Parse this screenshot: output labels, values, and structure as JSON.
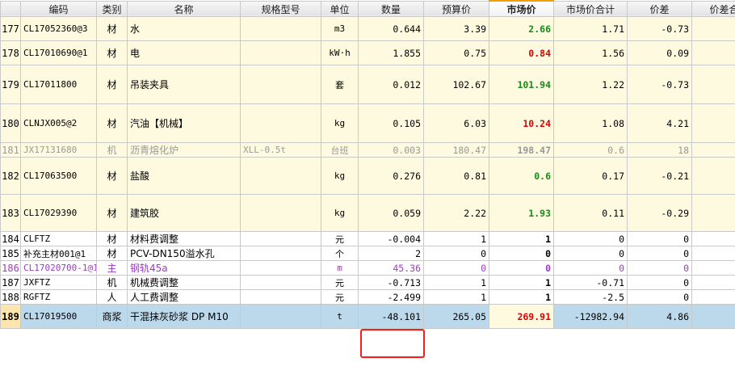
{
  "columns": {
    "index": "",
    "code": "编码",
    "category": "类别",
    "name": "名称",
    "spec": "规格型号",
    "unit": "单位",
    "quantity": "数量",
    "budget_price": "预算价",
    "market_price": "市场价",
    "market_total": "市场价合计",
    "price_diff": "价差",
    "diff_total": "价差合"
  },
  "rows": [
    {
      "idx": "177",
      "code": "CL17052360@3",
      "cat": "材",
      "name": "水",
      "spec": "",
      "unit": "m3",
      "qty": "0.644",
      "budget": "3.39",
      "market": "2.66",
      "market_color": "green",
      "total": "1.71",
      "diff": "-0.73",
      "style": "yellow"
    },
    {
      "idx": "178",
      "code": "CL17010690@1",
      "cat": "材",
      "name": "电",
      "spec": "",
      "unit": "kW·h",
      "qty": "1.855",
      "budget": "0.75",
      "market": "0.84",
      "market_color": "red",
      "total": "1.56",
      "diff": "0.09",
      "style": "yellow"
    },
    {
      "idx": "179",
      "code": "CL17011800",
      "cat": "材",
      "name": "吊装夹具",
      "spec": "",
      "unit": "套",
      "qty": "0.012",
      "budget": "102.67",
      "market": "101.94",
      "market_color": "green",
      "total": "1.22",
      "diff": "-0.73",
      "style": "yellow"
    },
    {
      "idx": "180",
      "code": "CLNJX005@2",
      "cat": "材",
      "name": "汽油【机械】",
      "spec": "",
      "unit": "kg",
      "qty": "0.105",
      "budget": "6.03",
      "market": "10.24",
      "market_color": "red",
      "total": "1.08",
      "diff": "4.21",
      "style": "yellow"
    },
    {
      "idx": "181",
      "code": "JX17131680",
      "cat": "机",
      "name": "沥青熔化炉",
      "spec": "XLL-0.5t",
      "unit": "台班",
      "qty": "0.003",
      "budget": "180.47",
      "market": "198.47",
      "market_color": "red",
      "total": "0.6",
      "diff": "18",
      "style": "gray"
    },
    {
      "idx": "182",
      "code": "CL17063500",
      "cat": "材",
      "name": "盐酸",
      "spec": "",
      "unit": "kg",
      "qty": "0.276",
      "budget": "0.81",
      "market": "0.6",
      "market_color": "green",
      "total": "0.17",
      "diff": "-0.21",
      "style": "yellow"
    },
    {
      "idx": "183",
      "code": "CL17029390",
      "cat": "材",
      "name": "建筑胶",
      "spec": "",
      "unit": "kg",
      "qty": "0.059",
      "budget": "2.22",
      "market": "1.93",
      "market_color": "green",
      "total": "0.11",
      "diff": "-0.29",
      "style": "yellow"
    },
    {
      "idx": "184",
      "code": "CLFTZ",
      "cat": "材",
      "name": "材料费调整",
      "spec": "",
      "unit": "元",
      "qty": "-0.004",
      "budget": "1",
      "market": "1",
      "market_color": "black",
      "total": "0",
      "diff": "0",
      "style": "white"
    },
    {
      "idx": "185",
      "code": "补充主材001@1",
      "cat": "材",
      "name": "PCV-DN150溢水孔",
      "spec": "",
      "unit": "个",
      "qty": "2",
      "budget": "0",
      "market": "0",
      "market_color": "black",
      "total": "0",
      "diff": "0",
      "style": "white"
    },
    {
      "idx": "186",
      "code": "CL17020700-1@1",
      "cat": "主",
      "name": "钢轨45a",
      "spec": "",
      "unit": "m",
      "qty": "45.36",
      "budget": "0",
      "market": "0",
      "market_color": "black",
      "total": "0",
      "diff": "0",
      "style": "purple"
    },
    {
      "idx": "187",
      "code": "JXFTZ",
      "cat": "机",
      "name": "机械费调整",
      "spec": "",
      "unit": "元",
      "qty": "-0.713",
      "budget": "1",
      "market": "1",
      "market_color": "black",
      "total": "-0.71",
      "diff": "0",
      "style": "white"
    },
    {
      "idx": "188",
      "code": "RGFTZ",
      "cat": "人",
      "name": "人工费调整",
      "spec": "",
      "unit": "元",
      "qty": "-2.499",
      "budget": "1",
      "market": "1",
      "market_color": "black",
      "total": "-2.5",
      "diff": "0",
      "style": "white"
    },
    {
      "idx": "189",
      "code": "CL17019500",
      "cat": "商浆",
      "name": "干混抹灰砂浆 DP M10",
      "spec": "",
      "unit": "t",
      "qty": "-48.101",
      "budget": "265.05",
      "market": "269.91",
      "market_color": "red",
      "total": "-12982.94",
      "diff": "4.86",
      "style": "sel"
    }
  ],
  "row_heights": [
    30,
    30,
    48,
    48,
    18,
    46,
    46,
    18,
    18,
    18,
    18,
    18,
    30
  ],
  "colors": {
    "green": "#1a8a1a",
    "red": "#e00000",
    "highlight_box": "#ff1a1a",
    "selected_row": "#bcd9ec"
  }
}
